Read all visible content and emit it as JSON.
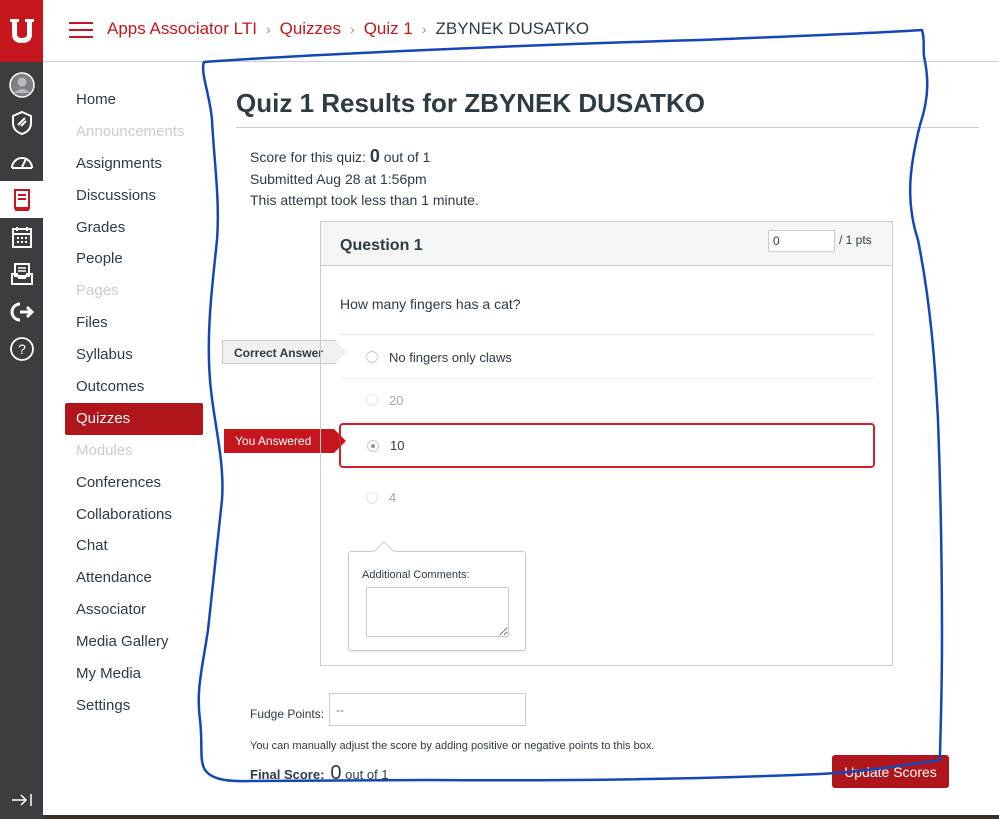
{
  "global_nav": {
    "logo_text": "U",
    "items": [
      "account",
      "admin",
      "dashboard",
      "courses",
      "calendar",
      "inbox",
      "commons",
      "help"
    ]
  },
  "breadcrumb": {
    "items": [
      "Apps Associator LTI",
      "Quizzes",
      "Quiz 1"
    ],
    "current": "ZBYNEK DUSATKO"
  },
  "course_nav": {
    "items": [
      {
        "label": "Home",
        "state": "normal"
      },
      {
        "label": "Announcements",
        "state": "disabled"
      },
      {
        "label": "Assignments",
        "state": "normal"
      },
      {
        "label": "Discussions",
        "state": "normal"
      },
      {
        "label": "Grades",
        "state": "normal"
      },
      {
        "label": "People",
        "state": "normal"
      },
      {
        "label": "Pages",
        "state": "disabled"
      },
      {
        "label": "Files",
        "state": "normal"
      },
      {
        "label": "Syllabus",
        "state": "normal"
      },
      {
        "label": "Outcomes",
        "state": "normal"
      },
      {
        "label": "Quizzes",
        "state": "active"
      },
      {
        "label": "Modules",
        "state": "disabled"
      },
      {
        "label": "Conferences",
        "state": "normal"
      },
      {
        "label": "Collaborations",
        "state": "normal"
      },
      {
        "label": "Chat",
        "state": "normal"
      },
      {
        "label": "Attendance",
        "state": "normal"
      },
      {
        "label": "Associator",
        "state": "normal"
      },
      {
        "label": "Media Gallery",
        "state": "normal"
      },
      {
        "label": "My Media",
        "state": "normal"
      },
      {
        "label": "Settings",
        "state": "normal"
      }
    ]
  },
  "main": {
    "title": "Quiz 1 Results for ZBYNEK DUSATKO",
    "score_prefix": "Score for this quiz: ",
    "score_value": "0",
    "score_suffix": " out of 1",
    "submitted": "Submitted Aug 28 at 1:56pm",
    "duration": "This attempt took less than 1 minute."
  },
  "question": {
    "title": "Question 1",
    "points_value": "0",
    "points_total": "/ 1 pts",
    "text": "How many fingers has a cat?",
    "correct_flag": "Correct Answer",
    "you_answered_flag": "You Answered",
    "answers": [
      "No fingers only claws",
      "20",
      "10",
      "4"
    ],
    "comments_label": "Additional Comments:"
  },
  "footer": {
    "fudge_label": "Fudge Points:",
    "fudge_placeholder": "--",
    "help_text": "You can manually adjust the score by adding positive or negative points to this box.",
    "final_label": "Final Score:",
    "final_value": "0",
    "final_suffix": " out of 1",
    "update_button": "Update Scores"
  },
  "colors": {
    "brand": "#c4161c",
    "nav_bg": "#3b3d40",
    "annotation": "#1546b8"
  }
}
